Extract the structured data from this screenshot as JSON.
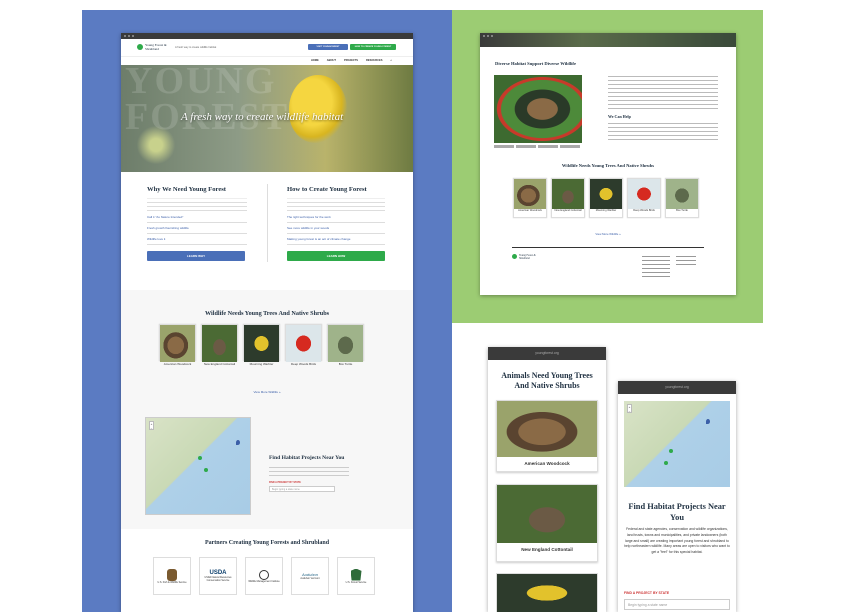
{
  "desktop": {
    "logo_text": "Young Forest & Shrubland",
    "tagline": "A fresh way to create wildlife habitat",
    "header_btn_1": "VISIT YOUNGFOREST",
    "header_btn_2": "HOW TO CREATE YOUNG FOREST",
    "nav": [
      "HOME",
      "ABOUT",
      "PROJECTS",
      "RESOURCES"
    ],
    "hero_watermark": "YOUNG FOREST",
    "hero_title": "A fresh way to create wildlife habitat",
    "col1": {
      "title": "Why We Need Young Forest",
      "links": [
        "Call it \"As Nature Intended\"",
        "Fresh growth flourishing wildlife",
        "Wildlife love it"
      ],
      "button": "LEARN WHY"
    },
    "col2": {
      "title": "How to Create Young Forest",
      "links": [
        "The right techniques for the work",
        "See more wildlife in your woods",
        "Making young forest is an act of climate change"
      ],
      "button": "LEARN HOW"
    },
    "wildlife_title": "Wildlife Needs Young Trees And Native Shrubs",
    "wildlife": [
      "American Woodcock",
      "New England Cottontail",
      "Mourning Warbler",
      "Deep Woods Birds",
      "Box Turtle"
    ],
    "view_more": "View More Wildlife »",
    "map_title": "Find Habitat Projects Near You",
    "map_label": "FIND A PROJECT BY STATE",
    "map_input": "Begin typing a state name",
    "partners_title": "Partners Creating Young Forests and Shrubland",
    "partners": [
      "U.S. Fish & Wildlife Service",
      "USDA Natural Resources Conservation Service",
      "Wildlife Management Institute",
      "Audubon Vermont",
      "U.S. Forest Service"
    ]
  },
  "article": {
    "title": "Diverse Habitat Support Diverse Wildlife",
    "subhead": "We Can Help",
    "wildlife_title": "Wildlife Needs Young Trees And Native Shrubs",
    "wildlife": [
      "American Woodcock",
      "New England Cottontail",
      "Mourning Warbler",
      "Deep Woods Birds",
      "Box Turtle"
    ],
    "view_more": "View More Wildlife »",
    "logo_text": "Young Forest & Shrubland"
  },
  "mobile1": {
    "url": "youngforest.org",
    "title": "Animals Need Young Trees And Native Shrubs",
    "cards": [
      "American Woodcock",
      "New England Cottontail"
    ]
  },
  "mobile2": {
    "url": "youngforest.org",
    "title": "Find Habitat Projects Near You",
    "body": "Federal and state agencies, conservation and wildlife organizations, land trusts, towns and municipalities, and private landowners (both large and small) are creating important young forest and shrubland to help northeastern wildlife. Many areas are open to visitors who want to get a \"feel\" for this special habitat.",
    "label": "FIND A PROJECT BY STATE",
    "input": "Begin typing a state name"
  },
  "colors": {
    "blue_panel": "#5b7bc2",
    "green_panel": "#9ccc73",
    "button_blue": "#4a6fb8",
    "button_green": "#2eaa4a",
    "link": "#3b5fa8"
  }
}
